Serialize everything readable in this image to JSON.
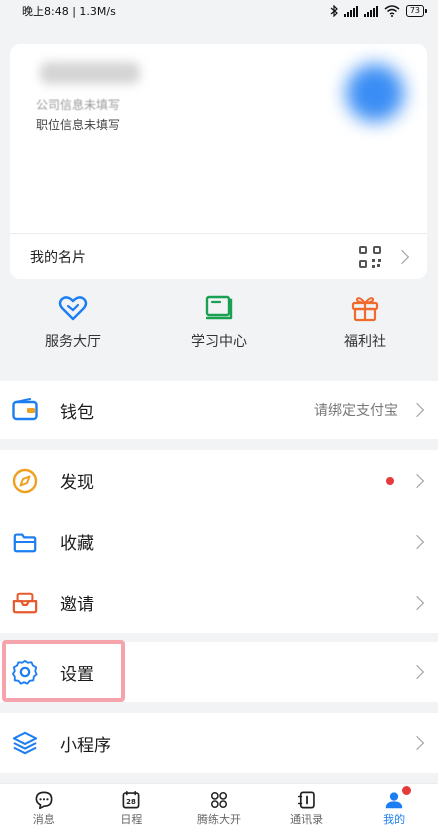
{
  "status_bar": {
    "left": "晚上8:48 | 1.3M/s",
    "signal_labels": [
      "HD",
      "HD"
    ],
    "battery": "73"
  },
  "profile_card": {
    "company": "公司信息未填写",
    "position": "职位信息未填写",
    "business_card_label": "我的名片"
  },
  "quick_actions": [
    {
      "label": "服务大厅",
      "icon": "heart-outline-icon",
      "color": "#1d7ef2"
    },
    {
      "label": "学习中心",
      "icon": "book-icon",
      "color": "#1aa052"
    },
    {
      "label": "福利社",
      "icon": "gift-icon",
      "color": "#f06a2c"
    }
  ],
  "menu": {
    "wallet": {
      "label": "钱包",
      "value": "请绑定支付宝",
      "icon": "wallet-icon",
      "color": "#1d7ef2"
    },
    "discover": {
      "label": "发现",
      "icon": "compass-icon",
      "color": "#f0a020"
    },
    "favorites": {
      "label": "收藏",
      "icon": "folder-icon",
      "color": "#1d7ef2"
    },
    "invite": {
      "label": "邀请",
      "icon": "invite-tray-icon",
      "color": "#e85a2c"
    },
    "settings": {
      "label": "设置",
      "icon": "gear-icon",
      "color": "#1d7ef2"
    },
    "mini_programs": {
      "label": "小程序",
      "icon": "layers-icon",
      "color": "#1d7ef2"
    }
  },
  "tabbar": {
    "items": [
      {
        "label": "消息",
        "icon": "chat-bubble-icon"
      },
      {
        "label": "日程",
        "icon": "calendar-icon",
        "day": "28"
      },
      {
        "label": "腾练大开",
        "icon": "apps-grid-icon"
      },
      {
        "label": "通讯录",
        "icon": "contacts-book-icon"
      },
      {
        "label": "我的",
        "icon": "person-icon",
        "active": true
      }
    ],
    "active_color": "#1d7ef2"
  }
}
